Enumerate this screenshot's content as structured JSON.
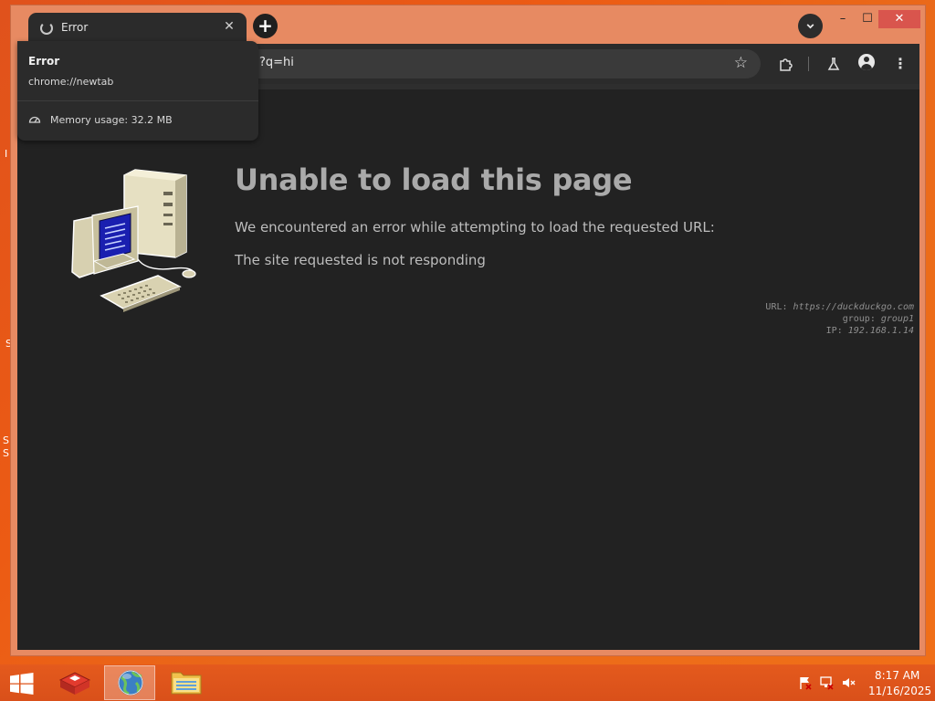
{
  "desktop": {
    "fragments": [
      "I",
      "S",
      "S",
      "S"
    ]
  },
  "tab": {
    "title": "Error",
    "close_glyph": "✕"
  },
  "window_controls": {
    "new_tab_glyph": "+",
    "tab_list_glyph": "⌄",
    "minimize_glyph": "–",
    "maximize_glyph": "☐",
    "close_glyph": "✕"
  },
  "omnibox": {
    "visible_url": "?q=hi"
  },
  "toolbar": {
    "icons": [
      "star-icon",
      "extensions-icon",
      "labs-icon",
      "profile-icon",
      "menu-icon"
    ]
  },
  "hovercard": {
    "title": "Error",
    "url": "chrome://newtab",
    "memory": "Memory usage: 32.2 MB"
  },
  "error_page": {
    "title": "Unable to load this page",
    "description": "We encountered an error while attempting to load the requested URL:",
    "reason": "The site requested is not responding",
    "meta": {
      "url_label": "URL:",
      "url_value": "https://duckduckgo.com",
      "group_label": "group:",
      "group_value": "group1",
      "ip_label": "IP:",
      "ip_value": "192.168.1.14"
    }
  },
  "taskbar": {
    "apps": [
      "app-launcher",
      "browser",
      "file-explorer"
    ],
    "time": "8:17 AM",
    "date": "11/16/2025"
  },
  "colors": {
    "desktop": "#e8501a",
    "window_frame": "#e78a62",
    "browser_dark": "#2b2b2b",
    "page_bg": "#222222",
    "close_red": "#d9554d",
    "heading_gray": "#aaaaaa"
  }
}
